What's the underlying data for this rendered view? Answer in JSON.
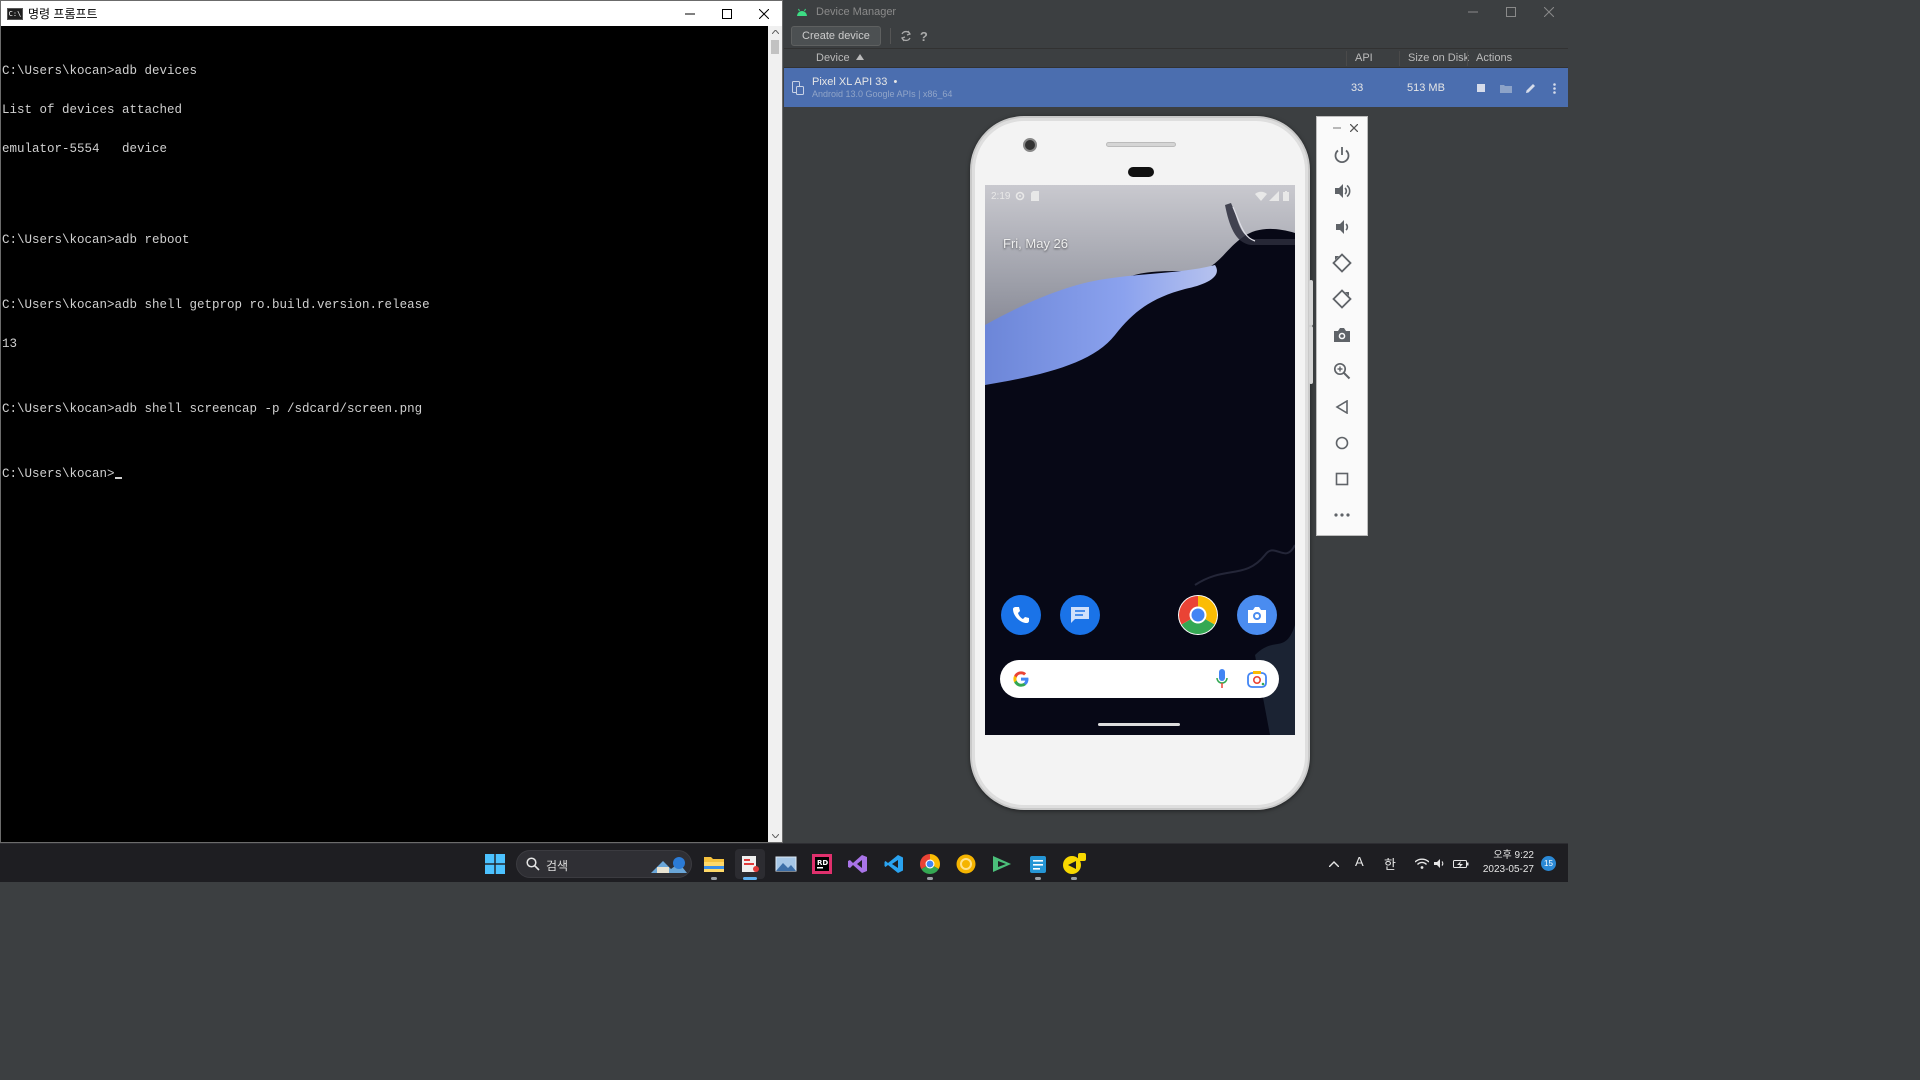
{
  "cmd": {
    "title": "명령 프롬프트",
    "app_icon_text": "C:\\",
    "lines": [
      "C:\\Users\\kocan>adb devices",
      "List of devices attached",
      "emulator-5554   device",
      "",
      "",
      "C:\\Users\\kocan>adb reboot",
      "",
      "C:\\Users\\kocan>adb shell getprop ro.build.version.release",
      "13",
      "",
      "C:\\Users\\kocan>adb shell screencap -p /sdcard/screen.png",
      "",
      "C:\\Users\\kocan>"
    ]
  },
  "device_manager": {
    "title": "Device Manager",
    "create_device_label": "Create device",
    "help_label": "?",
    "columns": {
      "device": "Device",
      "api": "API",
      "size": "Size on Disk",
      "actions": "Actions"
    },
    "row": {
      "name": "Pixel XL API 33",
      "running_marker": "•",
      "subtitle": "Android 13.0 Google APIs | x86_64",
      "api": "33",
      "size": "513 MB"
    }
  },
  "emulator": {
    "status_time": "2:19",
    "date": "Fri, May 26",
    "dock_apps": [
      "phone-icon",
      "messages-icon",
      "chrome-icon",
      "camera-icon"
    ],
    "toolbar": [
      "power-icon",
      "volume-up-icon",
      "volume-down-icon",
      "rotate-left-icon",
      "rotate-right-icon",
      "screenshot-icon",
      "zoom-icon",
      "back-icon",
      "home-icon",
      "overview-icon",
      "more-icon"
    ]
  },
  "taskbar": {
    "search_label": "검색",
    "ime_mode": "A",
    "ime_lang": "한",
    "time": "오후 9:22",
    "date": "2023-05-27",
    "notification_count": "15",
    "apps": [
      "start-icon",
      "file-explorer-icon",
      "screen-capture-icon",
      "photos-icon",
      "jetbrains-icon",
      "visual-studio-icon",
      "vscode-icon",
      "chrome-icon",
      "yellow-app-icon",
      "android-studio-icon",
      "notepad-icon",
      "kakaotalk-icon"
    ]
  },
  "colors": {
    "selected_row": "#4b6eaf",
    "ide_background": "#3c3f41",
    "console_background": "#000000",
    "taskbar_background": "#1e1e22"
  }
}
